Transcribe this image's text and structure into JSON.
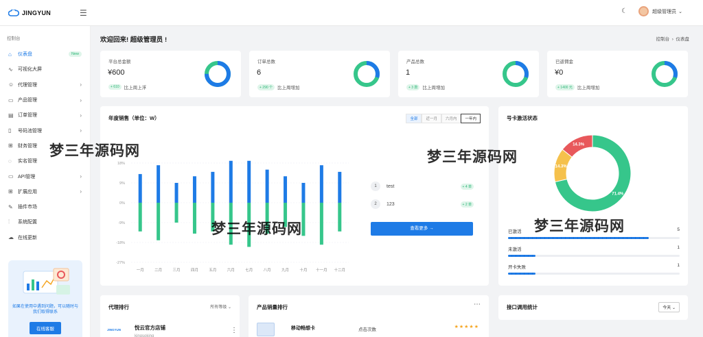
{
  "brand": {
    "name": "JINGYUN"
  },
  "header": {
    "user_name": "超级管理员",
    "user_caret": "⌄"
  },
  "sidebar": {
    "section": "控制台",
    "items": [
      {
        "label": "仪表盘",
        "icon": "home-icon",
        "glyph": "⌂",
        "active": true,
        "badge": "New"
      },
      {
        "label": "可视化大屏",
        "icon": "activity-icon",
        "glyph": "∿"
      },
      {
        "label": "代理管理",
        "icon": "users-icon",
        "glyph": "☺",
        "arrow": "›"
      },
      {
        "label": "产品管理",
        "icon": "box-icon",
        "glyph": "▭",
        "arrow": "›"
      },
      {
        "label": "订单管理",
        "icon": "cart-icon",
        "glyph": "▤",
        "arrow": "›"
      },
      {
        "label": "号码池管理",
        "icon": "phone-icon",
        "glyph": "▯",
        "arrow": "›"
      },
      {
        "label": "财务管理",
        "icon": "bank-icon",
        "glyph": "⊞"
      },
      {
        "label": "实名管理",
        "icon": "shield-icon",
        "glyph": "◌"
      },
      {
        "label": "API管理",
        "icon": "monitor-icon",
        "glyph": "▭",
        "arrow": "›"
      },
      {
        "label": "扩展应用",
        "icon": "grid-icon",
        "glyph": "⊞",
        "arrow": "›"
      },
      {
        "label": "插件市场",
        "icon": "wrench-icon",
        "glyph": "✎"
      },
      {
        "label": "系统配置",
        "icon": "sliders-icon",
        "glyph": "⫶"
      },
      {
        "label": "在线更新",
        "icon": "cloud-icon",
        "glyph": "☁"
      }
    ],
    "promo": {
      "text": "如果在使用中遇到问题，可以随时与我们取得联系",
      "button": "在线客服"
    }
  },
  "page": {
    "welcome": "欢迎回来! 超级管理员 !",
    "breadcrumb": [
      "控制台",
      "仪表盘"
    ]
  },
  "stats": [
    {
      "label": "平台总金额",
      "value": "¥600",
      "delta": "+ 610",
      "note": "比上周上浮",
      "progress": 0.75
    },
    {
      "label": "订单总数",
      "value": "6",
      "delta": "+ 290 个",
      "note": "比上周增加",
      "progress": 0.3
    },
    {
      "label": "产品总数",
      "value": "1",
      "delta": "+ 3 款",
      "note": "比上周增加",
      "progress": 0.3
    },
    {
      "label": "已返佣金",
      "value": "¥0",
      "delta": "+ 1400 元",
      "note": "比上周增加",
      "progress": 0.3
    }
  ],
  "sales": {
    "title": "年度销售（单位：W）",
    "ranges": [
      "全部",
      "近一月",
      "六月内",
      "一年内"
    ],
    "ranking": [
      {
        "rank": "1",
        "name": "test",
        "badge": "+ 4 单"
      },
      {
        "rank": "2",
        "name": "123",
        "badge": "+ 2 单"
      }
    ],
    "more_button": "查看更多 →"
  },
  "chart_data": {
    "type": "bar",
    "categories": [
      "一月",
      "二月",
      "三月",
      "四月",
      "五月",
      "六月",
      "七月",
      "八月",
      "九月",
      "十月",
      "十一月",
      "十二月"
    ],
    "y_ticks": [
      "18%",
      "9%",
      "0%",
      "-9%",
      "-18%",
      "-27%"
    ],
    "ylim": [
      -27,
      18
    ],
    "series": [
      {
        "values": [
          13,
          17,
          9,
          12,
          14,
          19,
          19,
          15,
          12,
          9,
          17,
          14
        ]
      },
      {
        "values": [
          -13,
          -17,
          -9,
          -14,
          -13,
          -19,
          -20,
          -14,
          -11,
          -15,
          -19,
          -13
        ]
      }
    ],
    "colors": [
      "#1e7be6",
      "#36c68b"
    ]
  },
  "activation": {
    "title": "号卡激活状态",
    "donut": [
      {
        "label": "71.4%",
        "value": 71.4,
        "color": "#36c68b"
      },
      {
        "label": "14.3%",
        "value": 14.3,
        "color": "#f5c14c"
      },
      {
        "label": "14.3%",
        "value": 14.3,
        "color": "#e8585b"
      }
    ],
    "rows": [
      {
        "label": "已激活",
        "count": "5",
        "fill": 0.82
      },
      {
        "label": "未激活",
        "count": "1",
        "fill": 0.16
      },
      {
        "label": "开卡失败",
        "count": "1",
        "fill": 0.16
      }
    ]
  },
  "agent_rank": {
    "title": "代理排行",
    "filter": "所有等级 ⌄",
    "first": {
      "name": "悦云官方店铺",
      "sub": "kingsoking",
      "logo": "JINGYUN"
    }
  },
  "product_rank": {
    "title": "产品销量排行",
    "first": {
      "name": "移动畅想卡",
      "metric": "点击次数",
      "stars": "★★★★★"
    }
  },
  "api_stats": {
    "title": "接口调用统计",
    "filter": "今天 ⌄"
  },
  "watermarks": [
    "梦三年源码网",
    "梦三年源码网",
    "梦三年源码网",
    "梦三年源码网"
  ]
}
